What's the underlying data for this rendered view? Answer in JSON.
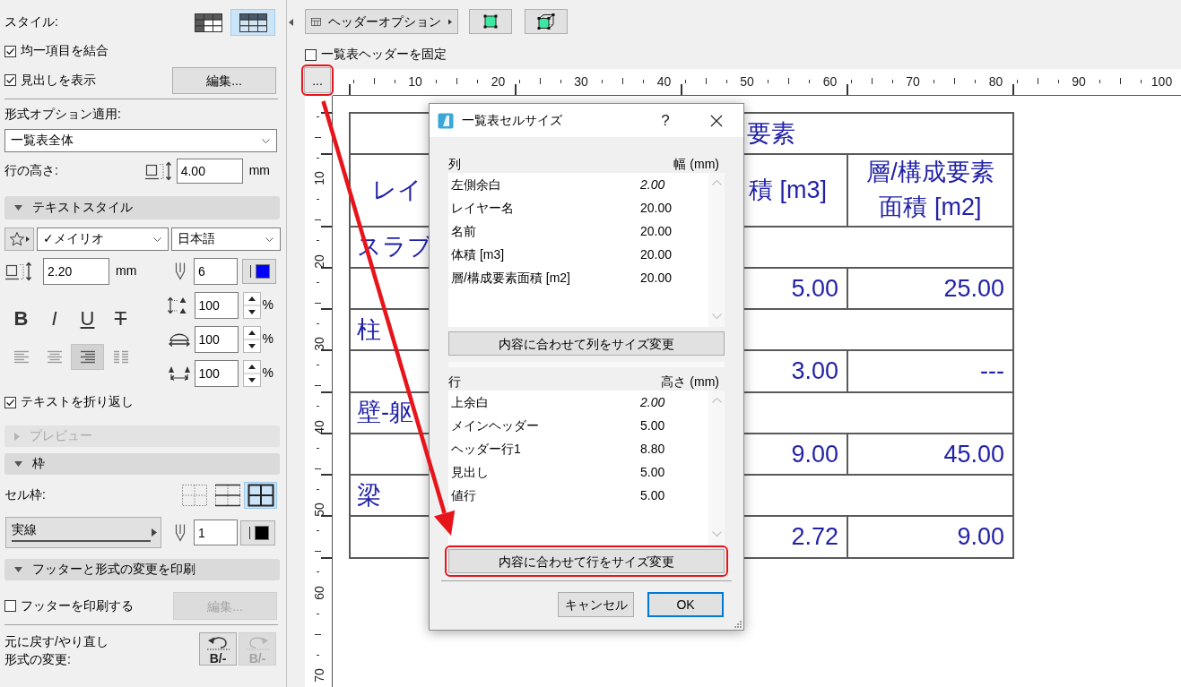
{
  "sidebar": {
    "style": {
      "label": "スタイル:",
      "options": [
        {
          "kind": "row_and_column_headers",
          "selected": false
        },
        {
          "kind": "header_row",
          "selected": true
        }
      ]
    },
    "merge_items": {
      "label": "均一項目を結合",
      "checked": true
    },
    "show_headings": {
      "label": "見出しを表示",
      "checked": true
    },
    "headings_edit_button": "編集...",
    "apply_format": {
      "label": "形式オプション適用:",
      "value": "一覧表全体"
    },
    "row_height": {
      "label": "行の高さ:",
      "value": "4.00",
      "unit": "mm"
    },
    "text_style": {
      "title": "テキストスタイル",
      "expanded": true,
      "font": "✓メイリオ",
      "language": "日本語",
      "size": "2.20",
      "size_unit": "mm",
      "pen": "6",
      "format_buttons": [
        {
          "kind": "bold",
          "label": "B"
        },
        {
          "kind": "italic",
          "label": "I"
        },
        {
          "kind": "underline",
          "label": "U"
        },
        {
          "kind": "strike",
          "label": "T"
        }
      ],
      "alignment": [
        {
          "kind": "left",
          "selected": false
        },
        {
          "kind": "center",
          "selected": false
        },
        {
          "kind": "right",
          "selected": true
        },
        {
          "kind": "justify",
          "selected": false
        }
      ],
      "scales": [
        {
          "kind": "line_spacing",
          "value": "100",
          "unit": "%"
        },
        {
          "kind": "width",
          "value": "100",
          "unit": "%"
        },
        {
          "kind": "spacing",
          "value": "100",
          "unit": "%"
        }
      ],
      "wrap_text": {
        "label": "テキストを折り返し",
        "checked": true
      }
    },
    "preview": {
      "title": "プレビュー",
      "expanded": false,
      "disabled": true
    },
    "frame": {
      "title": "枠",
      "expanded": true,
      "cell_border_label": "セル枠:",
      "border_options": [
        {
          "kind": "none",
          "selected": false
        },
        {
          "kind": "horizontal",
          "selected": false
        },
        {
          "kind": "all",
          "selected": true
        }
      ],
      "line_type": "実線",
      "pen": "1"
    },
    "print": {
      "title": "フッターと形式の変更を印刷",
      "expanded": true,
      "print_footer": {
        "label": "フッターを印刷する",
        "checked": false
      },
      "edit_button": {
        "label": "編集...",
        "disabled": true
      }
    },
    "undo": {
      "label": "元に戻す/やり直し形式の変更:",
      "buttons": [
        {
          "kind": "undo",
          "label": "B/-",
          "disabled": false
        },
        {
          "kind": "redo",
          "label": "B/-",
          "disabled": true
        }
      ]
    }
  },
  "toolbar": {
    "header_options": "ヘッダーオプション",
    "freeze_header": {
      "label": "一覧表ヘッダーを固定",
      "checked": false
    }
  },
  "ruler": {
    "button": {
      "label": "...",
      "highlighted": true
    },
    "horizontal": [
      "10",
      "20",
      "30",
      "40",
      "50",
      "60",
      "70",
      "80",
      "90",
      "100"
    ],
    "vertical": [
      "10",
      "20",
      "30",
      "40",
      "50",
      "60",
      "70"
    ]
  },
  "table": {
    "main_header": "要素",
    "header_row": {
      "column_1": "レイ",
      "column_3": "積 [m3]",
      "column_4": "層/構成要素面積 [m2]"
    },
    "groups": [
      {
        "heading": "スラブ",
        "column_3": "5.00",
        "column_4": "25.00"
      },
      {
        "heading": "柱",
        "column_3": "3.00",
        "column_4": "---"
      },
      {
        "heading": "壁-躯",
        "column_3": "9.00",
        "column_4": "45.00"
      },
      {
        "heading": "梁",
        "column_3": "2.72",
        "column_4": "9.00"
      }
    ]
  },
  "dialog": {
    "title": "一覧表セルサイズ",
    "help_button": "?",
    "columns": {
      "header": "列",
      "value_header": "幅 (mm)",
      "items": [
        {
          "kind": "margin",
          "name": "左側余白",
          "value": "2.00"
        },
        {
          "kind": "size",
          "name": "レイヤー名",
          "value": "20.00"
        },
        {
          "kind": "size",
          "name": "名前",
          "value": "20.00"
        },
        {
          "kind": "size",
          "name": "体積 [m3]",
          "value": "20.00"
        },
        {
          "kind": "size",
          "name": "層/構成要素面積 [m2]",
          "value": "20.00"
        }
      ]
    },
    "fit_columns_button": {
      "label": "内容に合わせて列をサイズ変更",
      "highlighted": false
    },
    "rows": {
      "header": "行",
      "value_header": "高さ (mm)",
      "items": [
        {
          "kind": "margin",
          "name": "上余白",
          "value": "2.00"
        },
        {
          "kind": "size",
          "name": "メインヘッダー",
          "value": "5.00"
        },
        {
          "kind": "size",
          "name": "ヘッダー行1",
          "value": "8.80"
        },
        {
          "kind": "size",
          "name": "見出し",
          "value": "5.00"
        },
        {
          "kind": "size",
          "name": "値行",
          "value": "5.00"
        }
      ]
    },
    "fit_rows_button": {
      "label": "内容に合わせて行をサイズ変更",
      "highlighted": true
    },
    "buttons": [
      {
        "label": "キャンセル",
        "default": false
      },
      {
        "label": "OK",
        "default": true
      }
    ]
  }
}
